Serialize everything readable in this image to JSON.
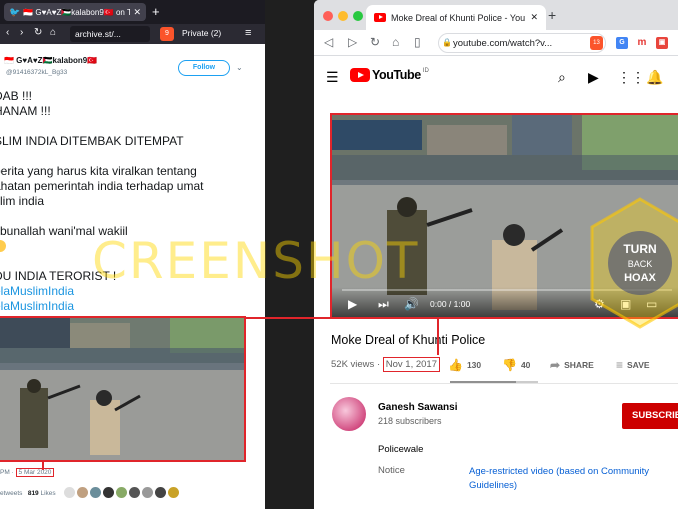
{
  "left_browser": {
    "tab_title": "🇮🇩 G♥A♥Z🇵🇸kalabon9🇹🇷 on Twitt",
    "url": "archive.st/...",
    "shield_count": "9",
    "private_label": "Private (2)"
  },
  "tweet": {
    "display_name": "🇮🇩 G♥A♥Z🇵🇸kalabon9🇹🇷",
    "handle": "@91416372kL_Bg33",
    "follow_label": "Follow",
    "lines": [
      "DAB !!!",
      "HANAM !!!",
      "",
      "SLIM INDIA DITEMBAK DITEMPAT",
      "",
      "berita yang harus kita viralkan tentang",
      "ahatan pemerintah india terhadap umat",
      "slim india",
      "",
      "sbunallah wani'mal wakiil",
      "",
      "",
      "DU INDIA TERORIST !"
    ],
    "hashtags": [
      "elaMuslimIndia",
      "elaMuslimIndia"
    ],
    "time_prefix": "PM · ",
    "date": "5 Mar 2020",
    "retweets_suffix": "etweets",
    "likes_count": "819",
    "likes_label": "Likes"
  },
  "right_browser": {
    "tab_title": "Moke Dreal of Khunti Police - YouT",
    "url": "youtube.com/watch?v...",
    "brave_count": "13"
  },
  "youtube": {
    "logo_text": "YouTube",
    "logo_country": "ID",
    "time_display": "0:00 / 1:00",
    "title": "Moke Dreal of Khunti Police",
    "views": "52K views",
    "separator": " · ",
    "date": "Nov 1, 2017",
    "likes": "130",
    "dislikes": "40",
    "share_label": "SHARE",
    "save_label": "SAVE",
    "channel_name": "Ganesh Sawansi",
    "subscribers": "218 subscribers",
    "subscribe_label": "SUBSCRIBE",
    "description": "Policewale",
    "notice_label": "Notice",
    "notice_value": "Age-restricted video (based on Community Guidelines)"
  },
  "watermark": {
    "text": "CREENSHOT",
    "badge_lines": [
      "TURN",
      "BACK",
      "HOAX"
    ]
  },
  "colors": {
    "highlight_red": "#e0252b",
    "yt_red": "#ff0000",
    "link_blue": "#065fd4",
    "twitter_blue": "#1da1f2",
    "subscribe_red": "#cc0000"
  }
}
